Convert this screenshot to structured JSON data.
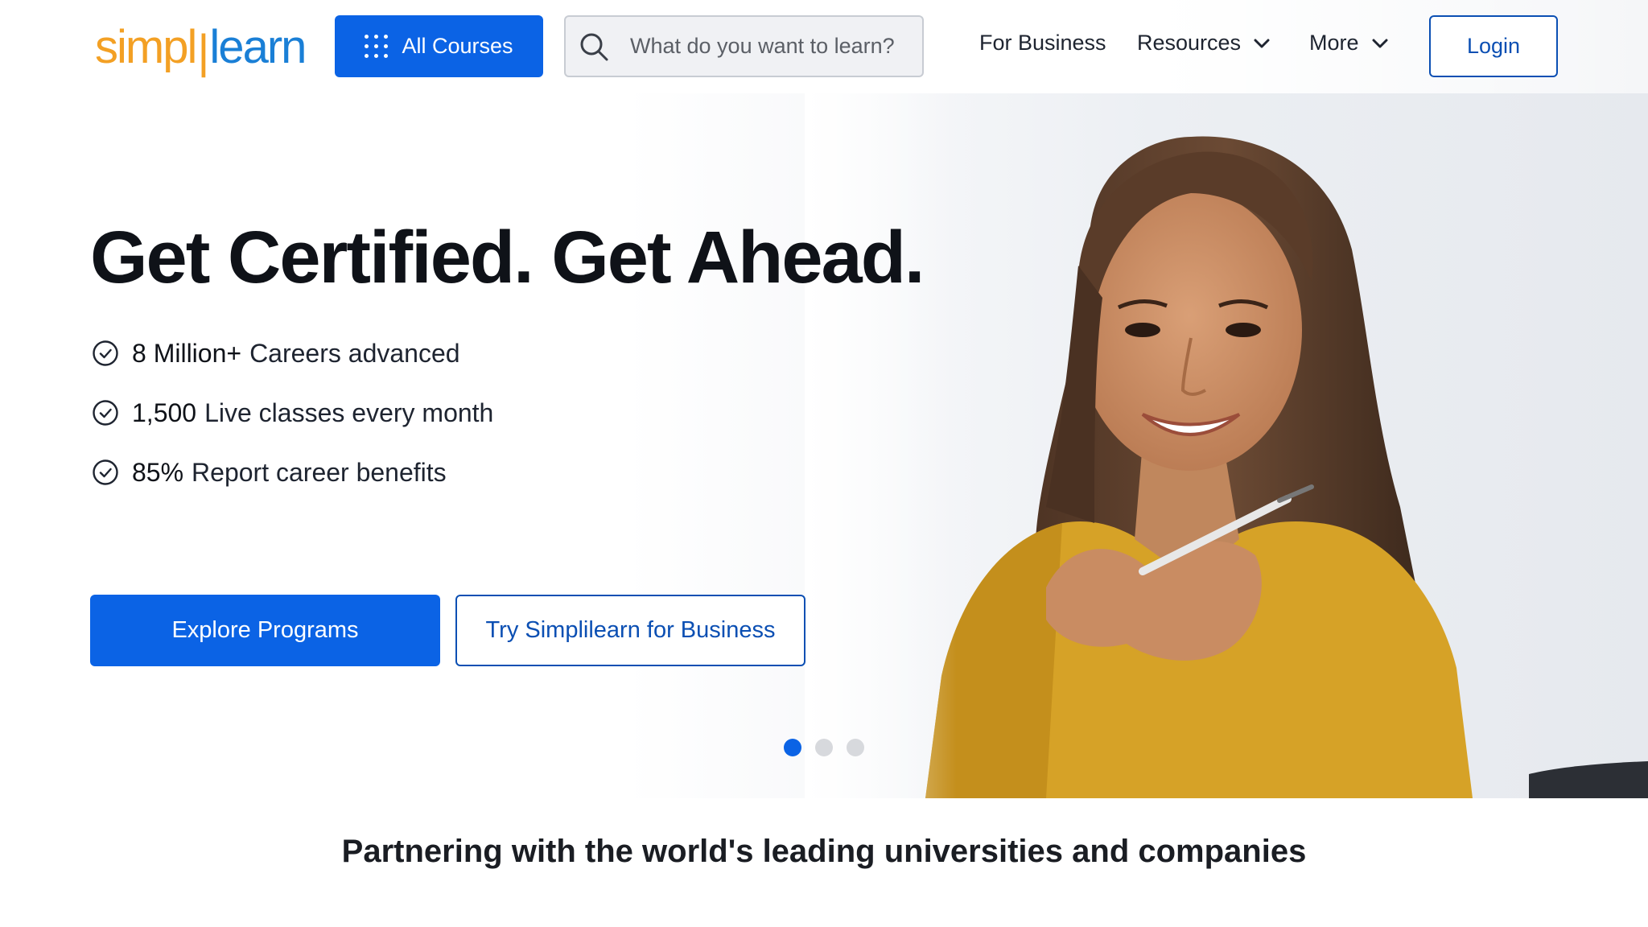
{
  "header": {
    "logo": {
      "part1": "simpl",
      "part2": "|",
      "part3": "learn",
      "colors": {
        "simpl": "#f3a024",
        "learn": "#1a7fd6"
      }
    },
    "all_courses_label": "All Courses",
    "search": {
      "placeholder": "What do you want to learn?",
      "value": ""
    },
    "nav": {
      "business": "For Business",
      "resources": "Resources",
      "more": "More"
    },
    "login_label": "Login"
  },
  "hero": {
    "headline": "Get Certified. Get Ahead.",
    "stats": [
      {
        "number": "8 Million+",
        "text": "Careers advanced"
      },
      {
        "number": "1,500",
        "text": "Live classes every month"
      },
      {
        "number": "85%",
        "text": "Report career benefits"
      }
    ],
    "primary_cta": "Explore Programs",
    "secondary_cta": "Try Simplilearn for Business",
    "carousel": {
      "count": 3,
      "active": 1
    }
  },
  "partners": {
    "heading": "Partnering with the world's leading universities and companies"
  },
  "colors": {
    "primary": "#0b63e5",
    "outline": "#0b4fb3",
    "headline": "#0f1218"
  },
  "icons": [
    "grid-icon",
    "search-icon",
    "chevron-down-icon",
    "check-circle-icon"
  ]
}
